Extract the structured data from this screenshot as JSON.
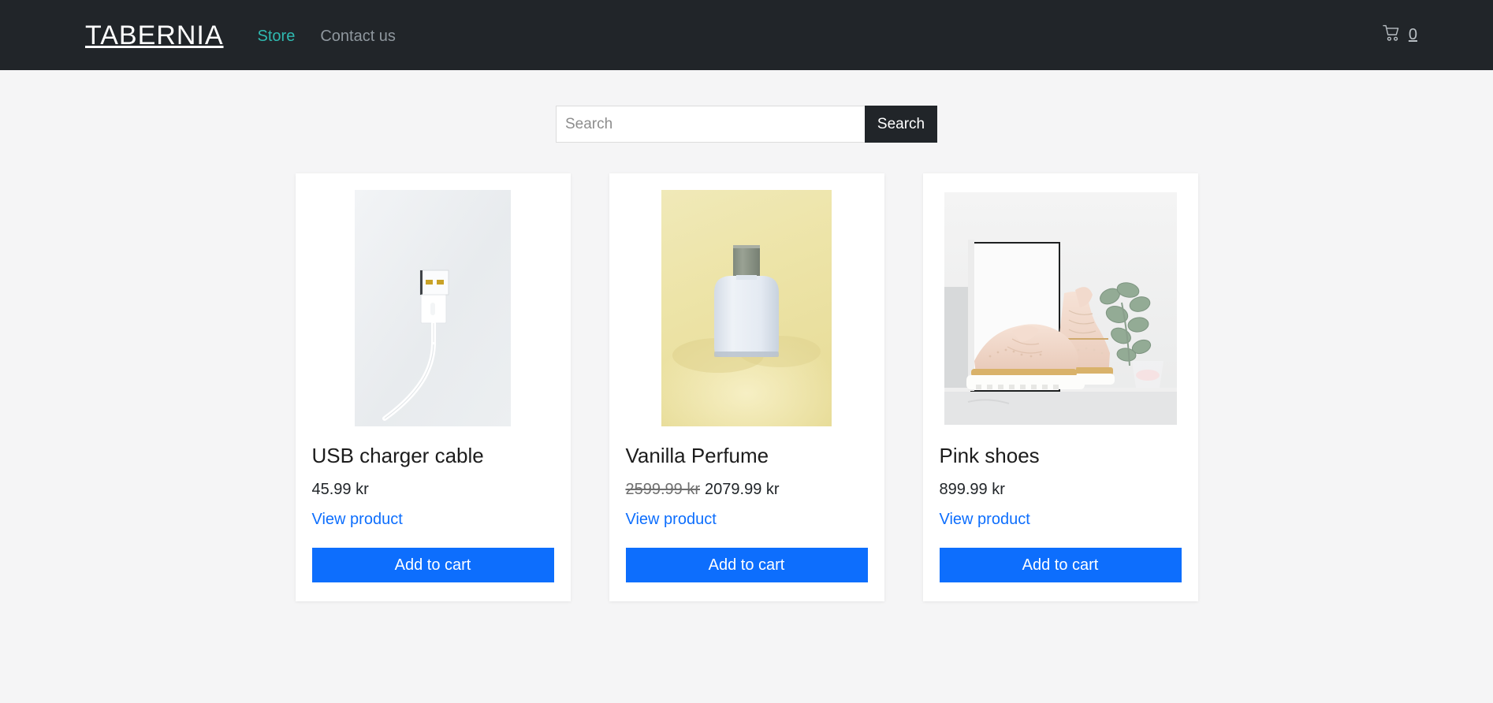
{
  "header": {
    "brand": "TABERNIA",
    "nav": [
      {
        "label": "Store",
        "state": "active"
      },
      {
        "label": "Contact us",
        "state": "muted"
      }
    ],
    "cart": {
      "icon": "shopping-cart-icon",
      "count": "0"
    },
    "background_color": "#212529",
    "active_link_color": "#2fb9b0"
  },
  "search": {
    "placeholder": "Search",
    "value": "",
    "button_label": "Search",
    "button_color": "#212529"
  },
  "products": [
    {
      "title": "USB charger cable",
      "price": "45.99 kr",
      "old_price": "",
      "view_label": "View product",
      "add_label": "Add to cart",
      "image_alt": "white USB charger cable on light background"
    },
    {
      "title": "Vanilla Perfume",
      "price": "2079.99 kr",
      "old_price": "2599.99 kr",
      "view_label": "View product",
      "add_label": "Add to cart",
      "image_alt": "pale blue perfume bottle on yellow background"
    },
    {
      "title": "Pink shoes",
      "price": "899.99 kr",
      "old_price": "",
      "view_label": "View product",
      "add_label": "Add to cart",
      "image_alt": "pink brogue shoes with frame and plant"
    }
  ],
  "theme": {
    "page_background": "#f5f5f6",
    "card_background": "#ffffff",
    "link_color": "#0d6efd",
    "button_color": "#0d6efd"
  }
}
